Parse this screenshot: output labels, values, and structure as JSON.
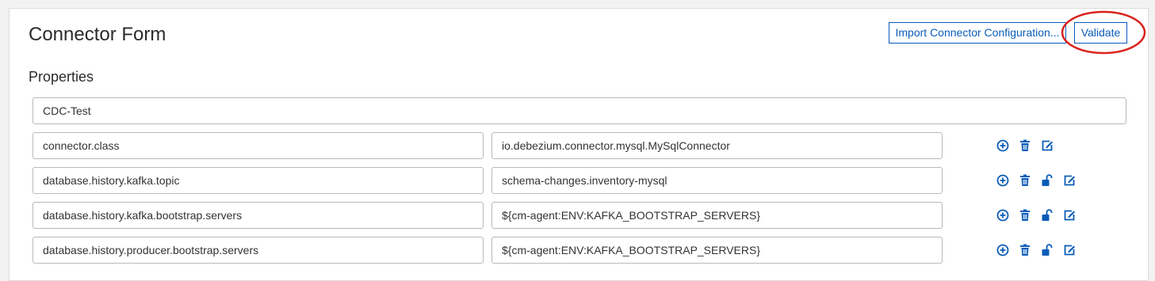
{
  "form": {
    "title": "Connector Form",
    "import_label": "Import Connector Configuration...",
    "validate_label": "Validate",
    "section_title": "Properties",
    "connector_name": "CDC-Test"
  },
  "properties": [
    {
      "key": "connector.class",
      "value": "io.debezium.connector.mysql.MySqlConnector",
      "icons": [
        "add-icon",
        "trash-icon",
        "edit-icon"
      ]
    },
    {
      "key": "database.history.kafka.topic",
      "value": "schema-changes.inventory-mysql",
      "icons": [
        "add-icon",
        "trash-icon",
        "unlock-icon",
        "edit-icon"
      ]
    },
    {
      "key": "database.history.kafka.bootstrap.servers",
      "value": "${cm-agent:ENV:KAFKA_BOOTSTRAP_SERVERS}",
      "icons": [
        "add-icon",
        "trash-icon",
        "unlock-icon",
        "edit-icon"
      ]
    },
    {
      "key": "database.history.producer.bootstrap.servers",
      "value": "${cm-agent:ENV:KAFKA_BOOTSTRAP_SERVERS}",
      "icons": [
        "add-icon",
        "trash-icon",
        "unlock-icon",
        "edit-icon"
      ]
    }
  ],
  "colors": {
    "accent": "#0a5cb8",
    "annotation": "#d9231d"
  }
}
